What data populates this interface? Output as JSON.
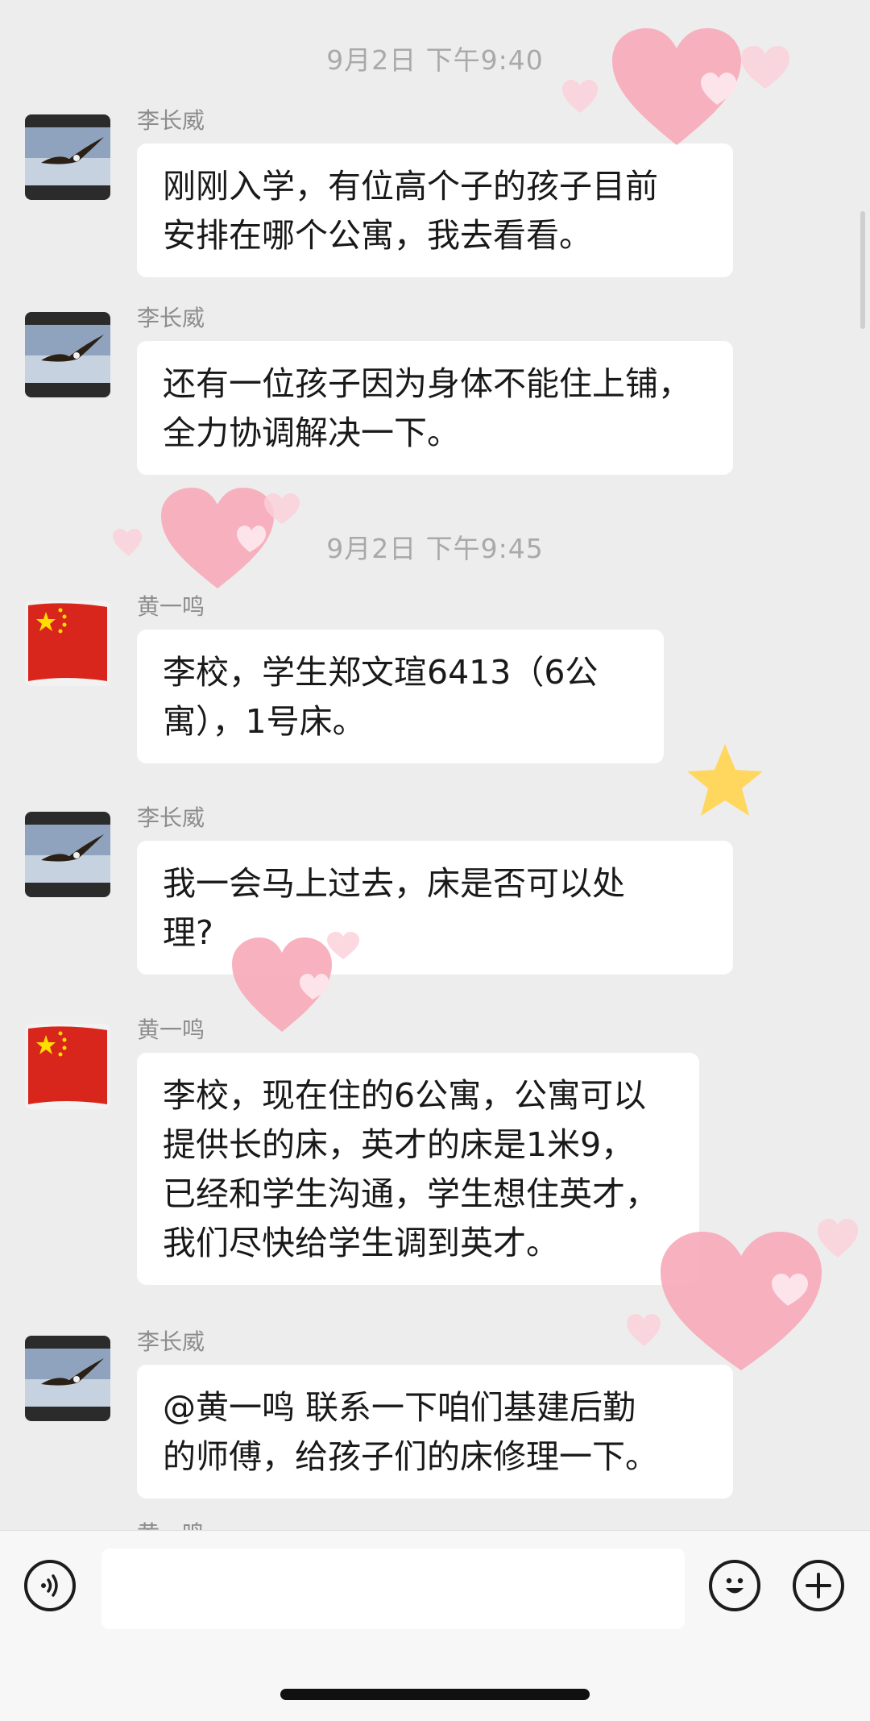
{
  "timestamps": [
    "9月2日 下午9:40",
    "9月2日 下午9:45"
  ],
  "messages": [
    {
      "sender": "李长威",
      "avatar": "eagle-icon",
      "text": "刚刚入学，有位高个子的孩子目前\n安排在哪个公寓，我去看看。"
    },
    {
      "sender": "李长威",
      "avatar": "eagle-icon",
      "text": "还有一位孩子因为身体不能住上铺，\n全力协调解决一下。"
    },
    {
      "sender": "黄一鸣",
      "avatar": "china-flag-icon",
      "text": "李校，学生郑文瑄6413（6公\n寓），1号床。"
    },
    {
      "sender": "李长威",
      "avatar": "eagle-icon",
      "text": "我一会马上过去，床是否可以处\n理?"
    },
    {
      "sender": "黄一鸣",
      "avatar": "china-flag-icon",
      "text": "李校，现在住的6公寓，公寓可以\n提供长的床，英才的床是1米9，\n已经和学生沟通，学生想住英才，\n我们尽快给学生调到英才。"
    },
    {
      "sender": "李长威",
      "avatar": "eagle-icon",
      "text": "@黄一鸣 联系一下咱们基建后勤\n的师傅，给孩子们的床修理一下。"
    },
    {
      "sender": "黄一鸣",
      "avatar": "china-flag-icon",
      "text": ""
    }
  ],
  "input_bar": {
    "voice_icon": "voice-icon",
    "emoji_icon": "smiley-icon",
    "plus_icon": "plus-icon",
    "text_value": ""
  },
  "colors": {
    "background": "#ededed",
    "bubble": "#ffffff",
    "timestamp": "#a9a9a9",
    "sender": "#8c8c8c",
    "heart": "#f7a8b8",
    "star": "#ffd75e"
  }
}
